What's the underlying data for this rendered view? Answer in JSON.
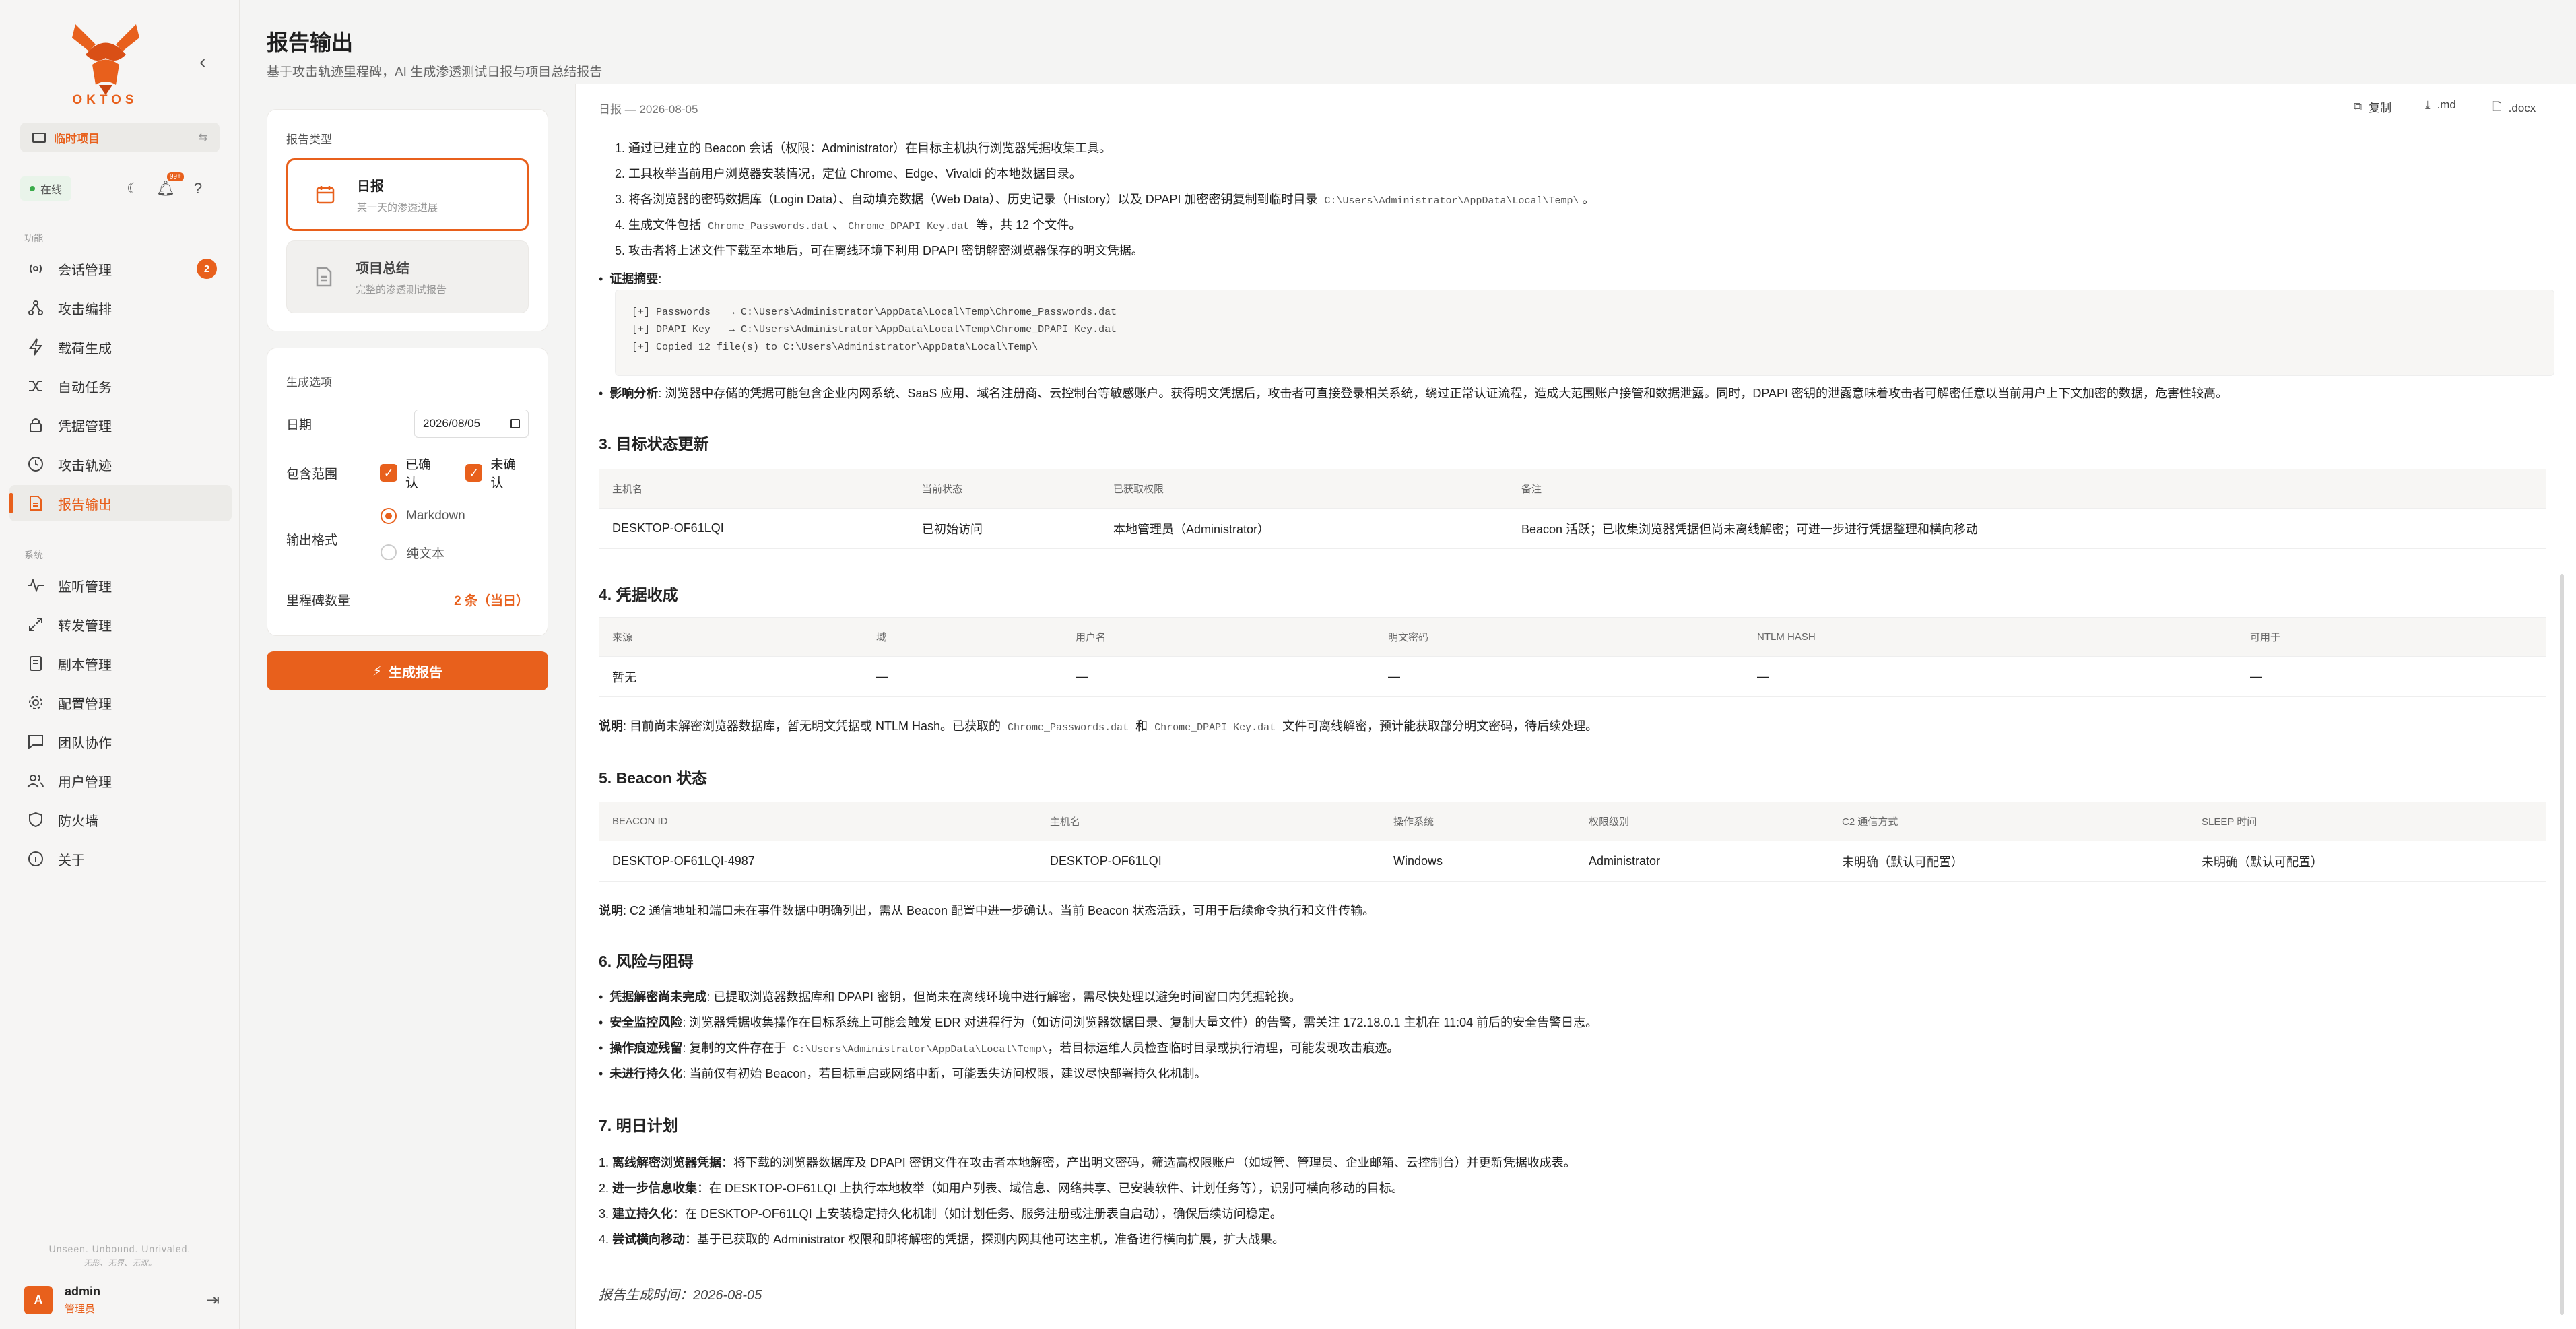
{
  "app": {
    "brand": "OKTOS",
    "accent": "#e8601c"
  },
  "sidebar": {
    "project": "临时项目",
    "status": "在线",
    "notif_badge": "99+",
    "group_main": "功能",
    "group_sys": "系统",
    "items_main": [
      {
        "label": "会话管理",
        "icon": "broadcast-icon",
        "badge": "2"
      },
      {
        "label": "攻击编排",
        "icon": "graph-icon"
      },
      {
        "label": "载荷生成",
        "icon": "bolt-icon"
      },
      {
        "label": "自动任务",
        "icon": "shuffle-icon"
      },
      {
        "label": "凭据管理",
        "icon": "lock-icon"
      },
      {
        "label": "攻击轨迹",
        "icon": "clock-icon"
      },
      {
        "label": "报告输出",
        "icon": "file-icon",
        "active": true
      }
    ],
    "items_sys": [
      {
        "label": "监听管理",
        "icon": "pulse-icon"
      },
      {
        "label": "转发管理",
        "icon": "expand-icon"
      },
      {
        "label": "剧本管理",
        "icon": "book-icon"
      },
      {
        "label": "配置管理",
        "icon": "gear-icon"
      },
      {
        "label": "团队协作",
        "icon": "chat-icon"
      },
      {
        "label": "用户管理",
        "icon": "users-icon"
      },
      {
        "label": "防火墙",
        "icon": "shield-icon"
      },
      {
        "label": "关于",
        "icon": "info-icon"
      }
    ],
    "tagline1": "Unseen. Unbound. Unrivaled.",
    "tagline2": "无形、无界、无双。",
    "user": {
      "initial": "A",
      "name": "admin",
      "role": "管理员"
    }
  },
  "header": {
    "title": "报告输出",
    "subtitle": "基于攻击轨迹里程碑，AI 生成渗透测试日报与项目总结报告"
  },
  "report_type": {
    "label": "报告类型",
    "options": [
      {
        "title": "日报",
        "desc": "某一天的渗透进展",
        "selected": true
      },
      {
        "title": "项目总结",
        "desc": "完整的渗透测试报告",
        "selected": false
      }
    ]
  },
  "gen_options": {
    "label": "生成选项",
    "date_label": "日期",
    "date_value": "2026/08/05",
    "scope_label": "包含范围",
    "scope_confirmed": "已确认",
    "scope_unconfirmed": "未确认",
    "format_label": "输出格式",
    "format_markdown": "Markdown",
    "format_text": "纯文本",
    "milestone_label": "里程碑数量",
    "milestone_value": "2 条（当日）"
  },
  "generate_button": "生成报告",
  "doc": {
    "label": "日报 — 2026-08-05",
    "copy": "复制",
    "md": ".md",
    "docx": ".docx",
    "steps": [
      "1. 通过已建立的 Beacon 会话（权限：Administrator）在目标主机执行浏览器凭据收集工具。",
      "2. 工具枚举当前用户浏览器安装情况，定位 Chrome、Edge、Vivaldi 的本地数据目录。",
      "3. 将各浏览器的密码数据库（Login Data）、自动填充数据（Web Data）、历史记录（History）以及 DPAPI 加密密钥复制到临时目录",
      "C:\\Users\\Administrator\\AppData\\Local\\Temp\\",
      "。",
      "4. 生成文件包括",
      "Chrome_Passwords.dat",
      "、",
      "Chrome_DPAPI Key.dat",
      "等，共 12 个文件。",
      "5. 攻击者将上述文件下载至本地后，可在离线环境下利用 DPAPI 密钥解密浏览器保存的明文凭据。"
    ],
    "evidence_title": "证据摘要",
    "evidence_lines": [
      "[+] Passwords   → C:\\Users\\Administrator\\AppData\\Local\\Temp\\Chrome_Passwords.dat",
      "[+] DPAPI Key   → C:\\Users\\Administrator\\AppData\\Local\\Temp\\Chrome_DPAPI Key.dat",
      "[+] Copied 12 file(s) to C:\\Users\\Administrator\\AppData\\Local\\Temp\\"
    ],
    "impact_title": "影响分析",
    "impact_text": "浏览器中存储的凭据可能包含企业内网系统、SaaS 应用、域名注册商、云控制台等敏感账户。获得明文凭据后，攻击者可直接登录相关系统，绕过正常认证流程，造成大范围账户接管和数据泄露。同时，DPAPI 密钥的泄露意味着攻击者可解密任意以当前用户上下文加密的数据，危害性较高。",
    "sec3_title": "3. 目标状态更新",
    "sec3_headers": [
      "主机名",
      "当前状态",
      "已获取权限",
      "备注"
    ],
    "sec3_row": [
      "DESKTOP-OF61LQI",
      "已初始访问",
      "本地管理员（Administrator）",
      "Beacon 活跃；已收集浏览器凭据但尚未离线解密；可进一步进行凭据整理和横向移动"
    ],
    "sec4_title": "4. 凭据收成",
    "sec4_headers": [
      "来源",
      "域",
      "用户名",
      "明文密码",
      "NTLM HASH",
      "可用于"
    ],
    "sec4_row": [
      "暂无",
      "—",
      "—",
      "—",
      "—",
      "—"
    ],
    "sec4_note_b": "说明",
    "sec4_note_a": ": 目前尚未解密浏览器数据库，暂无明文凭据或 NTLM Hash。已获取的",
    "sec4_note_c1": "Chrome_Passwords.dat",
    "sec4_note_and": "和",
    "sec4_note_c2": "Chrome_DPAPI Key.dat",
    "sec4_note_end": "文件可离线解密，预计能获取部分明文密码，待后续处理。",
    "sec5_title": "5. Beacon 状态",
    "sec5_headers": [
      "BEACON ID",
      "主机名",
      "操作系统",
      "权限级别",
      "C2 通信方式",
      "SLEEP 时间"
    ],
    "sec5_row": [
      "DESKTOP-OF61LQI-4987",
      "DESKTOP-OF61LQI",
      "Windows",
      "Administrator",
      "未明确（默认可配置）",
      "未明确（默认可配置）"
    ],
    "sec5_note_b": "说明",
    "sec5_note": ": C2 通信地址和端口未在事件数据中明确列出，需从 Beacon 配置中进一步确认。当前 Beacon 状态活跃，可用于后续命令执行和文件传输。",
    "sec6_title": "6. 风险与阻碍",
    "risks": [
      {
        "b": "凭据解密尚未完成",
        "t": ": 已提取浏览器数据库和 DPAPI 密钥，但尚未在离线环境中进行解密，需尽快处理以避免时间窗口内凭据轮换。"
      },
      {
        "b": "安全监控风险",
        "t": ": 浏览器凭据收集操作在目标系统上可能会触发 EDR 对进程行为（如访问浏览器数据目录、复制大量文件）的告警，需关注 172.18.0.1 主机在 11:04 前后的安全告警日志。"
      },
      {
        "b": "操作痕迹残留",
        "t": ": 复制的文件存在于",
        "code": "C:\\Users\\Administrator\\AppData\\Local\\Temp\\",
        "t2": "，若目标运维人员检查临时目录或执行清理，可能发现攻击痕迹。"
      },
      {
        "b": "未进行持久化",
        "t": ": 当前仅有初始 Beacon，若目标重启或网络中断，可能丢失访问权限，建议尽快部署持久化机制。"
      }
    ],
    "sec7_title": "7. 明日计划",
    "plans": [
      {
        "n": "1.",
        "b": "离线解密浏览器凭据",
        "t": "：将下载的浏览器数据库及 DPAPI 密钥文件在攻击者本地解密，产出明文密码，筛选高权限账户（如域管、管理员、企业邮箱、云控制台）并更新凭据收成表。"
      },
      {
        "n": "2.",
        "b": "进一步信息收集",
        "t": "：在 DESKTOP-OF61LQI 上执行本地枚举（如用户列表、域信息、网络共享、已安装软件、计划任务等），识别可横向移动的目标。"
      },
      {
        "n": "3.",
        "b": "建立持久化",
        "t": "：在 DESKTOP-OF61LQI 上安装稳定持久化机制（如计划任务、服务注册或注册表自启动），确保后续访问稳定。"
      },
      {
        "n": "4.",
        "b": "尝试横向移动",
        "t": "：基于已获取的 Administrator 权限和即将解密的凭据，探测内网其他可达主机，准备进行横向扩展，扩大战果。"
      }
    ],
    "footer": "报告生成时间：2026-08-05"
  }
}
